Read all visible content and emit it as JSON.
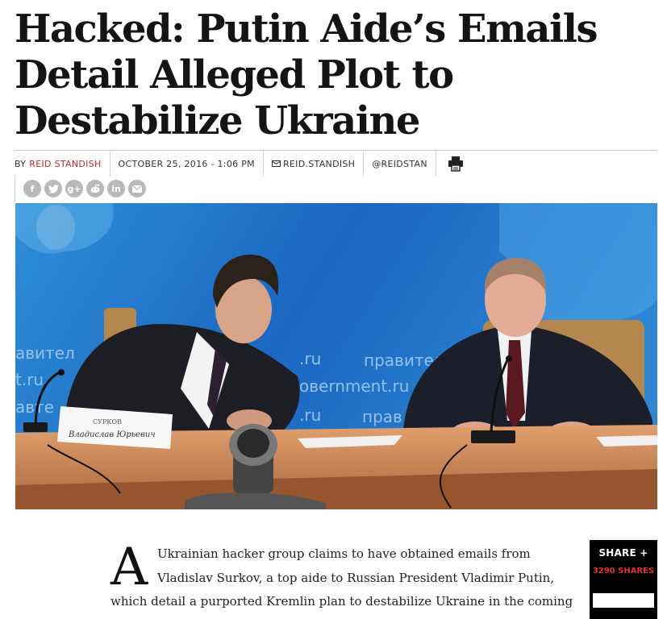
{
  "article": {
    "headline_lines": [
      "Hacked: Putin Aide’s Emails",
      "Detail Alleged Plot to",
      "Destabilize Ukraine"
    ],
    "byline_prefix": "BY",
    "author": "REID STANDISH",
    "date": "OCTOBER 25, 2016 - 1:06 PM",
    "email_handle": "REID.STANDISH",
    "twitter_handle": "@REIDSTAN",
    "social_icons": [
      "f",
      "t",
      "g+",
      "r",
      "in",
      "@"
    ],
    "dropcap": "A",
    "body_lines": [
      "Ukrainian hacker group claims to have obtained emails from",
      "Vladislav Surkov, a top aide to Russian President Vladimir Putin,",
      "which detail a purported Kremlin plan to destabilize Ukraine in the coming"
    ]
  },
  "photo": {
    "wall_texts": [
      "авител",
      ".ru",
      "правитель",
      "овernment.ru",
      ".ru",
      "прав",
      "t.ru",
      "авте"
    ],
    "nameplate_lines": [
      "СУРКОВ",
      "Владислав Юрьевич"
    ]
  },
  "share": {
    "label": "SHARE +",
    "count": "3290 SHARES"
  },
  "icons": [
    "mail-icon",
    "print-icon",
    "facebook-icon",
    "twitter-icon",
    "google-plus-icon",
    "reddit-icon",
    "linkedin-icon",
    "email-icon"
  ]
}
